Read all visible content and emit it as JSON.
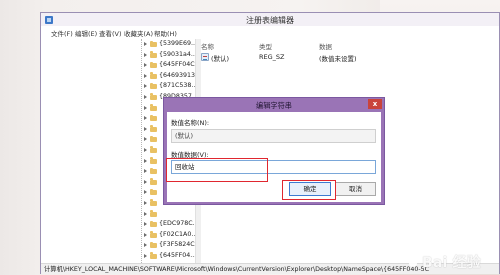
{
  "window": {
    "title": "注册表编辑器",
    "menu": [
      "文件(F)",
      "编辑(E)",
      "查看(V)",
      "收藏夹(A)",
      "帮助(H)"
    ]
  },
  "tree": {
    "items": [
      "{5399E69...",
      "{59031a4...",
      "{645FF04C...",
      "{64693913...",
      "{871C538...",
      "{89D8357...",
      "",
      "",
      "",
      "",
      "",
      "",
      "",
      "",
      "",
      "",
      "",
      "{EDC978C...",
      "{F02C1A0...",
      "{F3F5824C...",
      "{645FF04..."
    ]
  },
  "list": {
    "columns": [
      "名称",
      "类型",
      "数据"
    ],
    "rows": [
      {
        "name": "(默认)",
        "type": "REG_SZ",
        "data": "(数值未设置)"
      }
    ]
  },
  "statusbar": {
    "path": "计算机\\HKEY_LOCAL_MACHINE\\SOFTWARE\\Microsoft\\Windows\\CurrentVersion\\Explorer\\Desktop\\NameSpace\\{645FF040-5C"
  },
  "dialog": {
    "title": "编辑字符串",
    "name_label": "数值名称(N):",
    "name_value": "(默认)",
    "data_label": "数值数据(V):",
    "data_value": "回收站",
    "ok": "确定",
    "cancel": "取消",
    "close_glyph": "x"
  },
  "watermark": {
    "text": "Bai 经验"
  },
  "colors": {
    "dialog_frame": "#9a74b6",
    "highlight": "#e0272f",
    "folder": "#e9c163"
  }
}
